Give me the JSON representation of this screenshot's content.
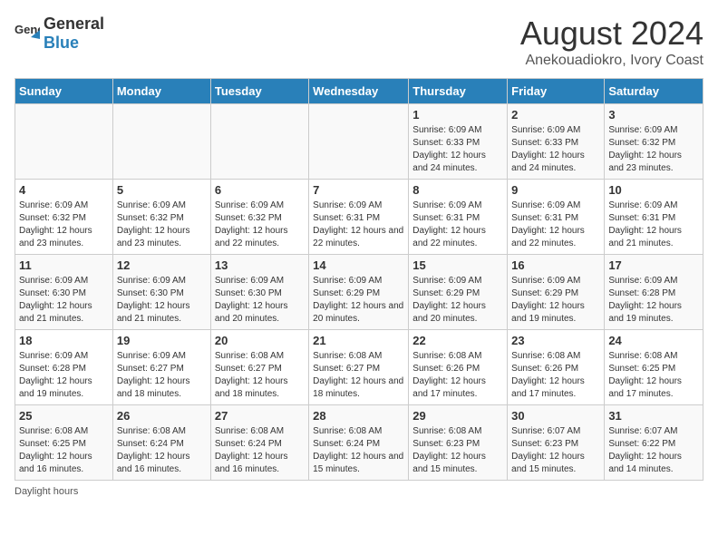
{
  "header": {
    "logo_general": "General",
    "logo_blue": "Blue",
    "title": "August 2024",
    "subtitle": "Anekouadiokro, Ivory Coast"
  },
  "weekdays": [
    "Sunday",
    "Monday",
    "Tuesday",
    "Wednesday",
    "Thursday",
    "Friday",
    "Saturday"
  ],
  "weeks": [
    [
      {
        "day": "",
        "info": ""
      },
      {
        "day": "",
        "info": ""
      },
      {
        "day": "",
        "info": ""
      },
      {
        "day": "",
        "info": ""
      },
      {
        "day": "1",
        "info": "Sunrise: 6:09 AM\nSunset: 6:33 PM\nDaylight: 12 hours and 24 minutes."
      },
      {
        "day": "2",
        "info": "Sunrise: 6:09 AM\nSunset: 6:33 PM\nDaylight: 12 hours and 24 minutes."
      },
      {
        "day": "3",
        "info": "Sunrise: 6:09 AM\nSunset: 6:32 PM\nDaylight: 12 hours and 23 minutes."
      }
    ],
    [
      {
        "day": "4",
        "info": "Sunrise: 6:09 AM\nSunset: 6:32 PM\nDaylight: 12 hours and 23 minutes."
      },
      {
        "day": "5",
        "info": "Sunrise: 6:09 AM\nSunset: 6:32 PM\nDaylight: 12 hours and 23 minutes."
      },
      {
        "day": "6",
        "info": "Sunrise: 6:09 AM\nSunset: 6:32 PM\nDaylight: 12 hours and 22 minutes."
      },
      {
        "day": "7",
        "info": "Sunrise: 6:09 AM\nSunset: 6:31 PM\nDaylight: 12 hours and 22 minutes."
      },
      {
        "day": "8",
        "info": "Sunrise: 6:09 AM\nSunset: 6:31 PM\nDaylight: 12 hours and 22 minutes."
      },
      {
        "day": "9",
        "info": "Sunrise: 6:09 AM\nSunset: 6:31 PM\nDaylight: 12 hours and 22 minutes."
      },
      {
        "day": "10",
        "info": "Sunrise: 6:09 AM\nSunset: 6:31 PM\nDaylight: 12 hours and 21 minutes."
      }
    ],
    [
      {
        "day": "11",
        "info": "Sunrise: 6:09 AM\nSunset: 6:30 PM\nDaylight: 12 hours and 21 minutes."
      },
      {
        "day": "12",
        "info": "Sunrise: 6:09 AM\nSunset: 6:30 PM\nDaylight: 12 hours and 21 minutes."
      },
      {
        "day": "13",
        "info": "Sunrise: 6:09 AM\nSunset: 6:30 PM\nDaylight: 12 hours and 20 minutes."
      },
      {
        "day": "14",
        "info": "Sunrise: 6:09 AM\nSunset: 6:29 PM\nDaylight: 12 hours and 20 minutes."
      },
      {
        "day": "15",
        "info": "Sunrise: 6:09 AM\nSunset: 6:29 PM\nDaylight: 12 hours and 20 minutes."
      },
      {
        "day": "16",
        "info": "Sunrise: 6:09 AM\nSunset: 6:29 PM\nDaylight: 12 hours and 19 minutes."
      },
      {
        "day": "17",
        "info": "Sunrise: 6:09 AM\nSunset: 6:28 PM\nDaylight: 12 hours and 19 minutes."
      }
    ],
    [
      {
        "day": "18",
        "info": "Sunrise: 6:09 AM\nSunset: 6:28 PM\nDaylight: 12 hours and 19 minutes."
      },
      {
        "day": "19",
        "info": "Sunrise: 6:09 AM\nSunset: 6:27 PM\nDaylight: 12 hours and 18 minutes."
      },
      {
        "day": "20",
        "info": "Sunrise: 6:08 AM\nSunset: 6:27 PM\nDaylight: 12 hours and 18 minutes."
      },
      {
        "day": "21",
        "info": "Sunrise: 6:08 AM\nSunset: 6:27 PM\nDaylight: 12 hours and 18 minutes."
      },
      {
        "day": "22",
        "info": "Sunrise: 6:08 AM\nSunset: 6:26 PM\nDaylight: 12 hours and 17 minutes."
      },
      {
        "day": "23",
        "info": "Sunrise: 6:08 AM\nSunset: 6:26 PM\nDaylight: 12 hours and 17 minutes."
      },
      {
        "day": "24",
        "info": "Sunrise: 6:08 AM\nSunset: 6:25 PM\nDaylight: 12 hours and 17 minutes."
      }
    ],
    [
      {
        "day": "25",
        "info": "Sunrise: 6:08 AM\nSunset: 6:25 PM\nDaylight: 12 hours and 16 minutes."
      },
      {
        "day": "26",
        "info": "Sunrise: 6:08 AM\nSunset: 6:24 PM\nDaylight: 12 hours and 16 minutes."
      },
      {
        "day": "27",
        "info": "Sunrise: 6:08 AM\nSunset: 6:24 PM\nDaylight: 12 hours and 16 minutes."
      },
      {
        "day": "28",
        "info": "Sunrise: 6:08 AM\nSunset: 6:24 PM\nDaylight: 12 hours and 15 minutes."
      },
      {
        "day": "29",
        "info": "Sunrise: 6:08 AM\nSunset: 6:23 PM\nDaylight: 12 hours and 15 minutes."
      },
      {
        "day": "30",
        "info": "Sunrise: 6:07 AM\nSunset: 6:23 PM\nDaylight: 12 hours and 15 minutes."
      },
      {
        "day": "31",
        "info": "Sunrise: 6:07 AM\nSunset: 6:22 PM\nDaylight: 12 hours and 14 minutes."
      }
    ]
  ],
  "footer": {
    "daylight_label": "Daylight hours"
  }
}
